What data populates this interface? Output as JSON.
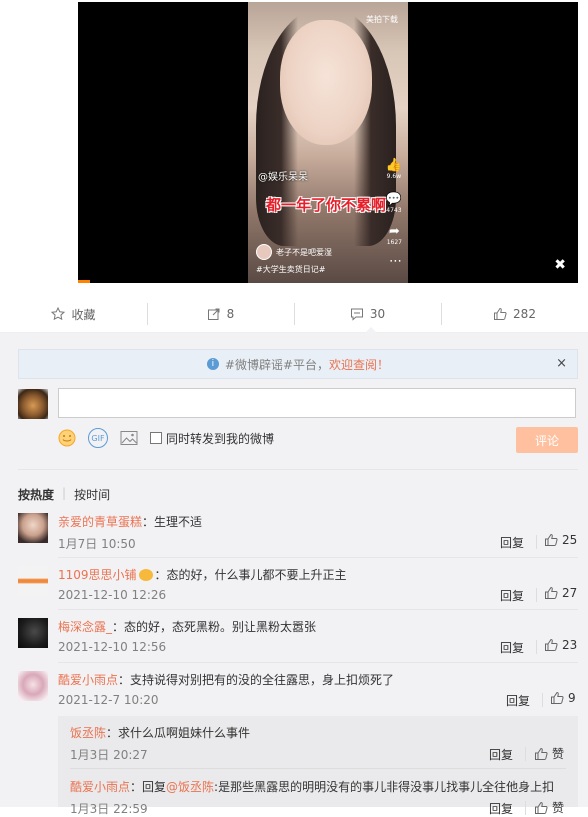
{
  "video": {
    "top_right_label": "美拍下载",
    "tag": "@娱乐呆呆",
    "caption": "都一年了你不累啊",
    "like_count": "9.6w",
    "comment_count": "4743",
    "share_count": "1627",
    "uploader": "老子不是吧爱湿",
    "hashtag": "#大学生卖货日记#"
  },
  "actions": [
    {
      "name": "favorite",
      "icon": "star-icon",
      "label": "收藏"
    },
    {
      "name": "repost",
      "icon": "repost-icon",
      "label": "8"
    },
    {
      "name": "comment",
      "icon": "comment-icon",
      "label": "30"
    },
    {
      "name": "like",
      "icon": "thumbs-up-icon",
      "label": "282"
    }
  ],
  "notice": {
    "text": "#微博辟谣#平台，",
    "link": "欢迎查阅！",
    "close": "×"
  },
  "composer": {
    "placeholder": "",
    "emoji_icon": "emoji-icon",
    "gif_label": "GIF",
    "image_icon": "image-icon",
    "repost_checkbox_label": "同时转发到我的微博",
    "submit_label": "评论"
  },
  "sort": {
    "hot": "按热度",
    "time": "按时间"
  },
  "comments": [
    {
      "user": "亲爱的青草蛋糕",
      "text": "：生理不适",
      "time": "1月7日 10:50",
      "reply": "回复",
      "likes": "25"
    },
    {
      "user": "1109思思小铺",
      "text": "：态的好，什么事儿都不要上升正主",
      "time": "2021-12-10 12:26",
      "reply": "回复",
      "likes": "27"
    },
    {
      "user": "梅深念露_",
      "text": "：态的好，态死黑粉。别让黑粉太嚣张",
      "time": "2021-12-10 12:56",
      "reply": "回复",
      "likes": "23"
    },
    {
      "user": "酷爱小雨点",
      "text": "：支持说得对别把有的没的全往露思，身上扣烦死了",
      "time": "2021-12-7 10:20",
      "reply": "回复",
      "likes": "9"
    }
  ],
  "sub_comments": [
    {
      "user": "饭丞陈",
      "text": "：求什么瓜啊姐妹什么事件",
      "time": "1月3日 20:27",
      "reply": "回复",
      "likes": "赞"
    },
    {
      "user": "酷爱小雨点",
      "prefix": "：回复",
      "mention": "@饭丞陈",
      "text": ":是那些黑露思的明明没有的事儿非得没事儿找事儿全往他身上扣",
      "time": "1月3日 22:59",
      "reply": "回复",
      "likes": "赞"
    }
  ],
  "colors": {
    "accent": "#eb7350",
    "link": "#eb7350",
    "submit_disabled": "#ffc09f",
    "panel_bg": "#f2f2f5"
  }
}
